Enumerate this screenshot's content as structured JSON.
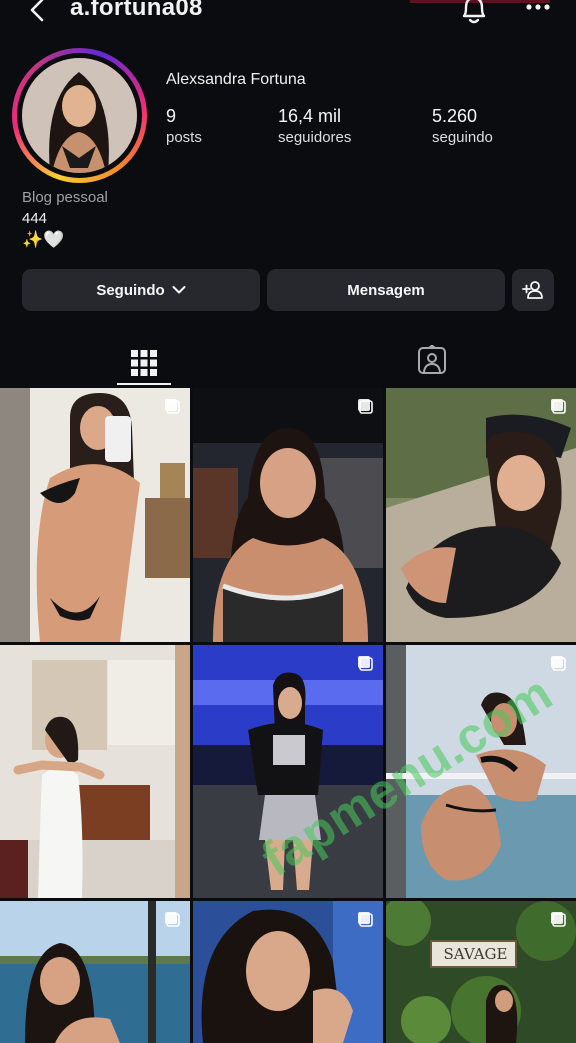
{
  "header": {
    "username": "a.fortuna08",
    "icons": [
      "back-chevron-icon",
      "bell-icon",
      "more-icon"
    ]
  },
  "profile": {
    "full_name": "Alexsandra Fortuna",
    "stats": [
      {
        "value": "9",
        "label": "posts"
      },
      {
        "value": "16,4 mil",
        "label": "seguidores"
      },
      {
        "value": "5.260",
        "label": "seguindo"
      }
    ],
    "bio": {
      "category": "Blog pessoal",
      "line1": "444",
      "line2": "✨🤍"
    }
  },
  "actions": {
    "following_label": "Seguindo",
    "message_label": "Mensagem",
    "add_icon": "add-person-icon"
  },
  "tabs": [
    {
      "icon": "grid-icon",
      "active": true
    },
    {
      "icon": "tagged-person-icon",
      "active": false
    }
  ],
  "grid": {
    "tiles": [
      {
        "icon": "multi-select-icon"
      },
      {
        "icon": "multi-select-icon"
      },
      {
        "icon": "multi-select-icon"
      },
      {
        "icon": ""
      },
      {
        "icon": "multi-select-icon"
      },
      {
        "icon": "multi-select-icon"
      },
      {
        "icon": "multi-select-icon"
      },
      {
        "icon": "multi-select-icon"
      },
      {
        "icon": "multi-select-icon"
      }
    ],
    "overlay_text": "SAVAGE"
  },
  "watermark": "fapmenu.com",
  "colors": {
    "background": "#0b0c10",
    "button": "#26282e",
    "secondary_text": "#a0a0a6"
  }
}
